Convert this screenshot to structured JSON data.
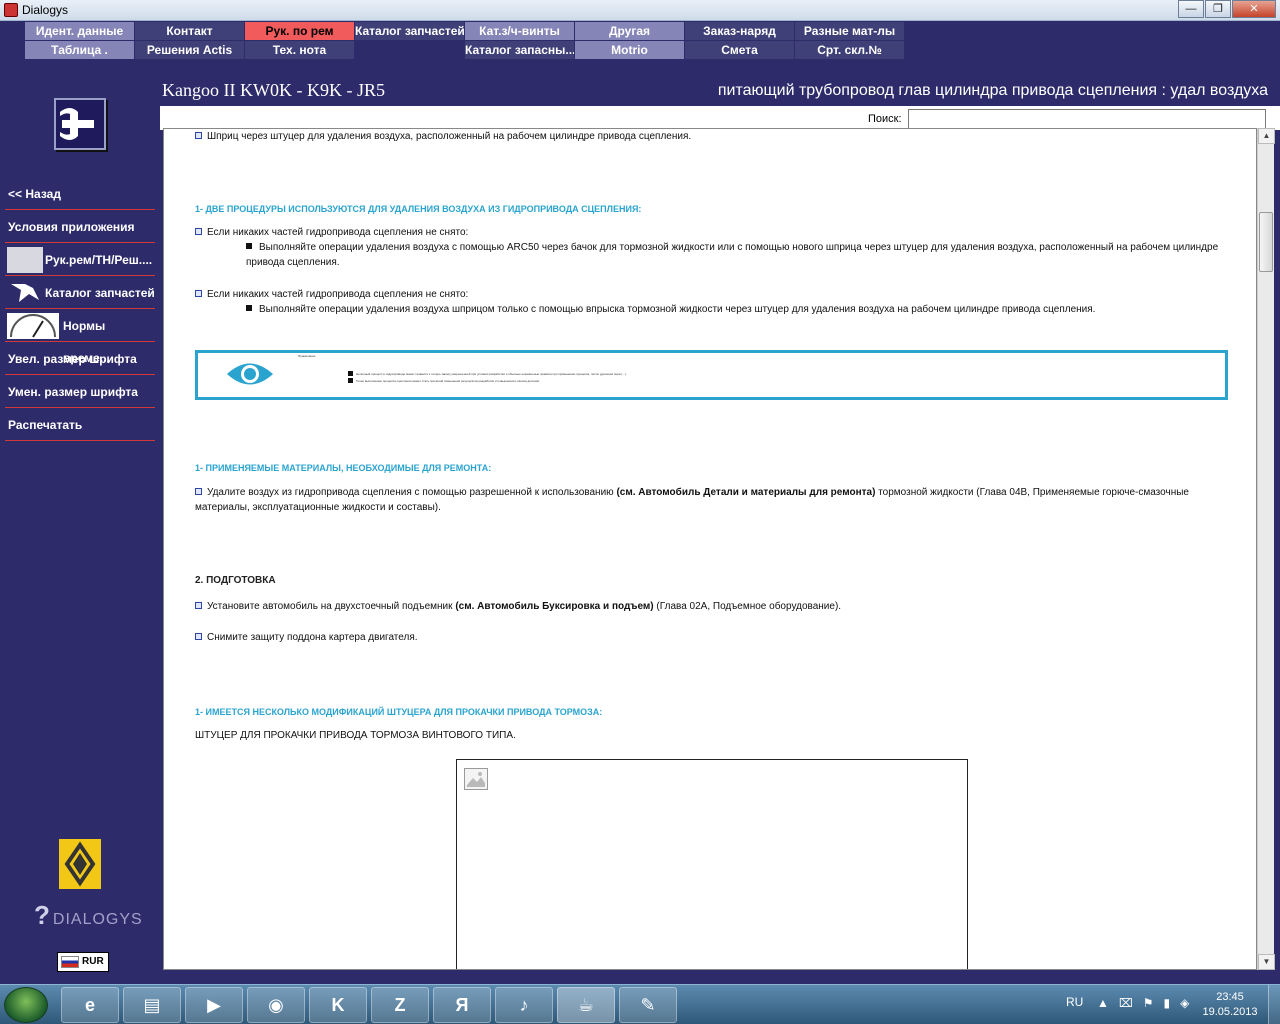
{
  "window": {
    "title": "Dialogys",
    "buttons": {
      "minimize": "—",
      "maximize": "❐",
      "close": "✕"
    }
  },
  "menu": {
    "row1": [
      "Идент. данные",
      "Контакт",
      "Рук. по рем",
      "Каталог запчастей",
      "Кат.з/ч-винты",
      "Другая",
      "Заказ-наряд",
      "Разные мат-лы"
    ],
    "row2": [
      "Таблица .",
      "Решения Actis",
      "Тех. нота",
      "",
      "Каталог запасны...",
      "Motrio",
      "Смета",
      "Срт. скл.№"
    ],
    "active": "Рук. по рем"
  },
  "header": {
    "vehicle": "Kangoo II KW0K - K9K - JR5",
    "doc_title": "питающий трубопровод глав цилиндра привода сцепления : удал воздуха"
  },
  "search": {
    "label": "Поиск:",
    "value": ""
  },
  "sidebar": {
    "links": [
      "<< Назад",
      "Условия приложения",
      "Рук.рем/ТН/Реш....",
      "Каталог запчастей",
      "Нормы време...",
      "Увел. размер шрифта",
      "Умен. размер шрифта",
      "Распечатать"
    ],
    "logo_text": "DIALOGYS",
    "currency": "RUR"
  },
  "content": {
    "line1": "Шприц через штуцер для удаления воздуха, расположенный на рабочем цилиндре привода сцепления.",
    "h1": "1- ДВЕ ПРОЦЕДУРЫ ИСПОЛЬЗУЮТСЯ ДЛЯ УДАЛЕНИЯ ВОЗДУХА ИЗ ГИДРОПРИВОДА СЦЕПЛЕНИЯ:",
    "case1": "Если никаких частей гидропривода сцепления не снято:",
    "case1_sub": "Выполняйте операции удаления воздуха с помощью ARC50 через бачок для тормозной жидкости или с помощью нового шприца через штуцер для удаления воздуха, расположенный на рабочем цилиндре привода сцепления.",
    "case2": "Если никаких частей гидропривода сцепления не снято:",
    "case2_sub": "Выполняйте операции удаления воздуха шприцом только с помощью впрыска тормозной жидкости через штуцер для удаления воздуха на рабочем цилиндре привода сцепления.",
    "note_title": "Примечание",
    "note_line1": "Неполный процесс в гидроприводе может привести к потерь запасу разрешенной при условии разработки и обычные нормальные правила при применении процесса, после удаления пера (...).",
    "note_line2": "Точно выполнение процесса сцепления может стать причиной повышения результатов разработки и повышенного износа деталей.",
    "h2": "1- ПРИМЕНЯЕМЫЕ МАТЕРИАЛЫ, НЕОБХОДИМЫЕ ДЛЯ РЕМОНТА:",
    "mat_pre": "Удалите воздух из гидропривода сцепления с помощью разрешенной к использованию ",
    "mat_bold": "(см. Автомобиль Детали и материалы для ремонта)",
    "mat_post": " тормозной жидкости (Глава 04В, Применяемые горюче-смазочные",
    "mat_line2": "материалы, эксплуатационные жидкости и составы).",
    "h3": "2. ПОДГОТОВКА",
    "prep1_pre": "Установите автомобиль на двухстоечный подъемник ",
    "prep1_bold": "(см. Автомобиль Буксировка и подъем)",
    "prep1_post": " (Глава 02А, Подъемное оборудование).",
    "prep2": "Снимите защиту поддона картера двигателя.",
    "h4": "1- ИМЕЕТСЯ НЕСКОЛЬКО МОДИФИКАЦИЙ ШТУЦЕРА ДЛЯ ПРОКАЧКИ ПРИВОДА ТОРМОЗА:",
    "fitting": "ШТУЦЕР ДЛЯ ПРОКАЧКИ ПРИВОДА ТОРМОЗА ВИНТОВОГО ТИПА."
  },
  "taskbar": {
    "lang": "RU",
    "time": "23:45",
    "date": "19.05.2013",
    "apps": [
      "ie-icon",
      "explorer-icon",
      "media-player-icon",
      "chrome-icon",
      "kaspersky-icon",
      "zello-icon",
      "yandex-icon",
      "audio-icon",
      "java-icon",
      "paint-icon"
    ]
  },
  "colors": {
    "background": "#2e2b6b",
    "menu_blue": "#8585b7",
    "menu_dark": "#404079",
    "active_tab": "#f25b5b",
    "heading_cyan": "#2aa4cf",
    "divider_red": "#d23a3a"
  }
}
